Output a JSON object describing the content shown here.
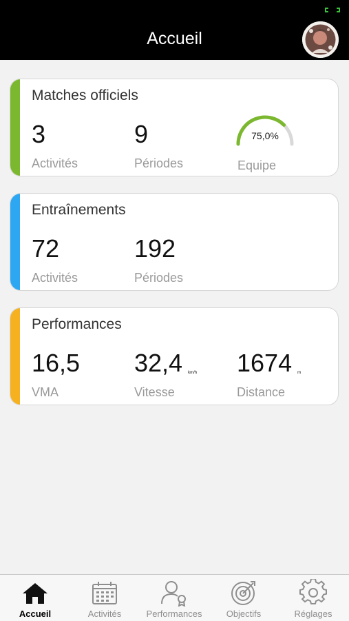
{
  "header": {
    "title": "Accueil"
  },
  "cards": [
    {
      "title": "Matches officiels",
      "accent": "#7cb82f",
      "stats": [
        {
          "value": "3",
          "label": "Activités"
        },
        {
          "value": "9",
          "label": "Périodes"
        }
      ],
      "gauge": {
        "percent_text": "75,0%",
        "fraction": 0.75,
        "label": "Equipe",
        "color": "#7cb82f"
      }
    },
    {
      "title": "Entraînements",
      "accent": "#2ea7f2",
      "stats": [
        {
          "value": "72",
          "label": "Activités"
        },
        {
          "value": "192",
          "label": "Périodes"
        }
      ]
    },
    {
      "title": "Performances",
      "accent": "#f5b120",
      "stats": [
        {
          "value": "16,5",
          "unit": "",
          "label": "VMA"
        },
        {
          "value": "32,4",
          "unit": "km/h",
          "label": "Vitesse"
        },
        {
          "value": "1674",
          "unit": "m",
          "label": "Distance"
        }
      ]
    }
  ],
  "tabs": [
    {
      "label": "Accueil",
      "icon": "home-icon",
      "active": true
    },
    {
      "label": "Activités",
      "icon": "calendar-icon",
      "active": false
    },
    {
      "label": "Performances",
      "icon": "user-award-icon",
      "active": false
    },
    {
      "label": "Objectifs",
      "icon": "target-icon",
      "active": false
    },
    {
      "label": "Réglages",
      "icon": "gear-icon",
      "active": false
    }
  ]
}
